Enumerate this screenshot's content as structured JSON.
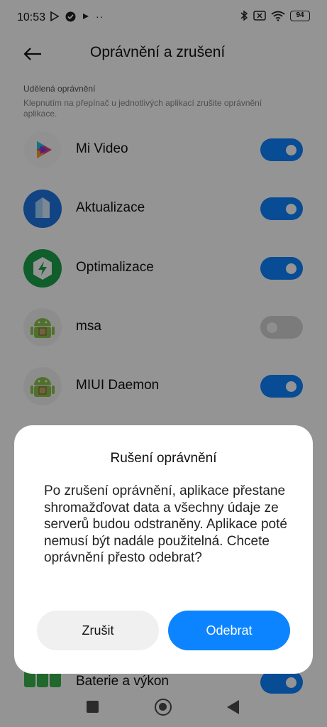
{
  "status_bar": {
    "time": "10:53",
    "battery": "94"
  },
  "header": {
    "title": "Oprávnění a zrušení"
  },
  "section": {
    "title": "Udělená oprávnění",
    "description": "Klepnutím na přepínač u jednotlivých aplikací zrušite oprávnění aplikace."
  },
  "apps": [
    {
      "name": "Mi Video",
      "icon": "mi-video-icon",
      "enabled": true
    },
    {
      "name": "Aktualizace",
      "icon": "update-icon",
      "enabled": true
    },
    {
      "name": "Optimalizace",
      "icon": "optimize-icon",
      "enabled": true
    },
    {
      "name": "msa",
      "icon": "android-icon",
      "enabled": false
    },
    {
      "name": "MIUI Daemon",
      "icon": "android-icon",
      "enabled": true
    },
    {
      "name": "Baterie a výkon",
      "icon": "battery-performance-icon",
      "enabled": true
    }
  ],
  "dialog": {
    "title": "Rušení oprávnění",
    "body": "Po zrušení oprávnění, aplikace přestane shromažďovat data a všechny údaje ze serverů budou odstraněny. Aplikace poté nemusí být nadále použitelná. Chcete oprávnění přesto odebrat?",
    "cancel_label": "Zrušit",
    "confirm_label": "Odebrat"
  },
  "colors": {
    "accent": "#0d84ff",
    "toggle_off": "#d4d4d4",
    "overlay": "rgba(0,0,0,0.42)"
  }
}
